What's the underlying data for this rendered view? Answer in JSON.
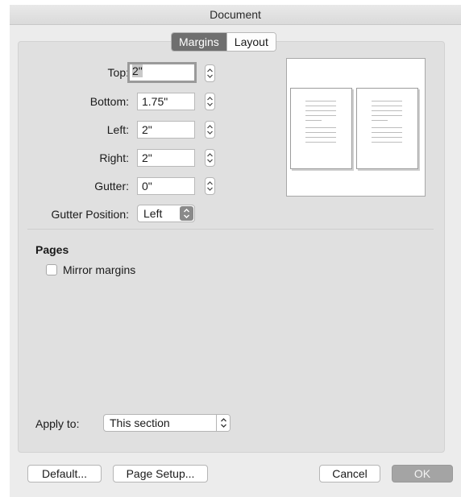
{
  "window": {
    "title": "Document"
  },
  "tabs": [
    {
      "label": "Margins",
      "active": true
    },
    {
      "label": "Layout",
      "active": false
    }
  ],
  "margins": [
    {
      "label": "Top:",
      "value": "2\""
    },
    {
      "label": "Bottom:",
      "value": "1.75\""
    },
    {
      "label": "Left:",
      "value": "2\""
    },
    {
      "label": "Right:",
      "value": "2\""
    },
    {
      "label": "Gutter:",
      "value": "0\""
    }
  ],
  "gutter_position": {
    "label": "Gutter Position:",
    "value": "Left"
  },
  "pages": {
    "title": "Pages",
    "mirror_label": "Mirror margins",
    "mirror_checked": false
  },
  "apply_to": {
    "label": "Apply to:",
    "value": "This section"
  },
  "buttons": {
    "default": "Default...",
    "page_setup": "Page Setup...",
    "cancel": "Cancel",
    "ok": "OK"
  },
  "icons": {
    "stepper": "stepper-arrows-icon",
    "popup": "popup-chevrons-icon"
  }
}
